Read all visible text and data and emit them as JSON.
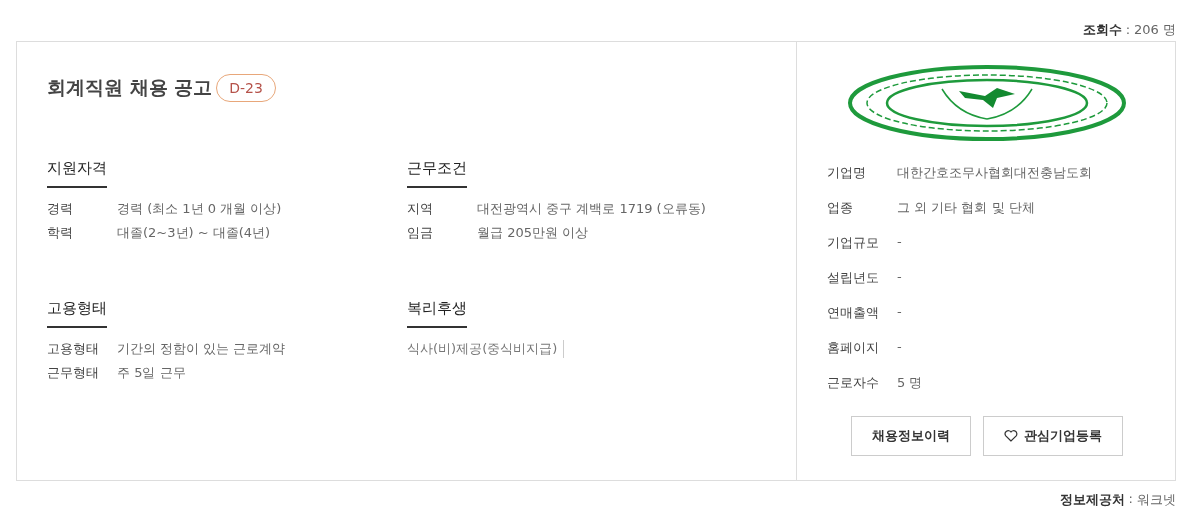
{
  "view_count": {
    "label": "조회수",
    "separator": ":",
    "value": "206 명"
  },
  "job": {
    "title": "회계직원 채용 공고",
    "badge": "D-23",
    "sections": [
      {
        "title": "지원자격",
        "kind": "table",
        "rows": [
          {
            "label": "경력",
            "value": "경력 (최소 1년 0 개월 이상)"
          },
          {
            "label": "학력",
            "value": "대졸(2~3년) ~ 대졸(4년)"
          }
        ]
      },
      {
        "title": "근무조건",
        "kind": "table",
        "rows": [
          {
            "label": "지역",
            "value": "대전광역시 중구 계백로 1719 (오류동)"
          },
          {
            "label": "임금",
            "value": "월급 205만원 이상"
          }
        ]
      },
      {
        "title": "고용형태",
        "kind": "table",
        "rows": [
          {
            "label": "고용형태",
            "value": "기간의 정함이 있는 근로계약"
          },
          {
            "label": "근무형태",
            "value": "주 5일 근무"
          }
        ]
      },
      {
        "title": "복리후생",
        "kind": "tags",
        "tags": [
          "식사(비)제공(중식비지급)"
        ]
      }
    ]
  },
  "company": {
    "info": [
      {
        "label": "기업명",
        "value": "대한간호조무사협회대전충남도회"
      },
      {
        "label": "업종",
        "value": "그 외 기타 협회 및 단체"
      },
      {
        "label": "기업규모",
        "value": "-"
      },
      {
        "label": "설립년도",
        "value": "-"
      },
      {
        "label": "연매출액",
        "value": "-"
      },
      {
        "label": "홈페이지",
        "value": "-"
      },
      {
        "label": "근로자수",
        "value": "5 명"
      }
    ],
    "buttons": [
      {
        "label": "채용정보이력",
        "kind": "plain"
      },
      {
        "label": "관심기업등록",
        "kind": "favorite"
      }
    ]
  },
  "source": {
    "label": "정보제공처",
    "separator": ":",
    "value": "워크넷"
  }
}
